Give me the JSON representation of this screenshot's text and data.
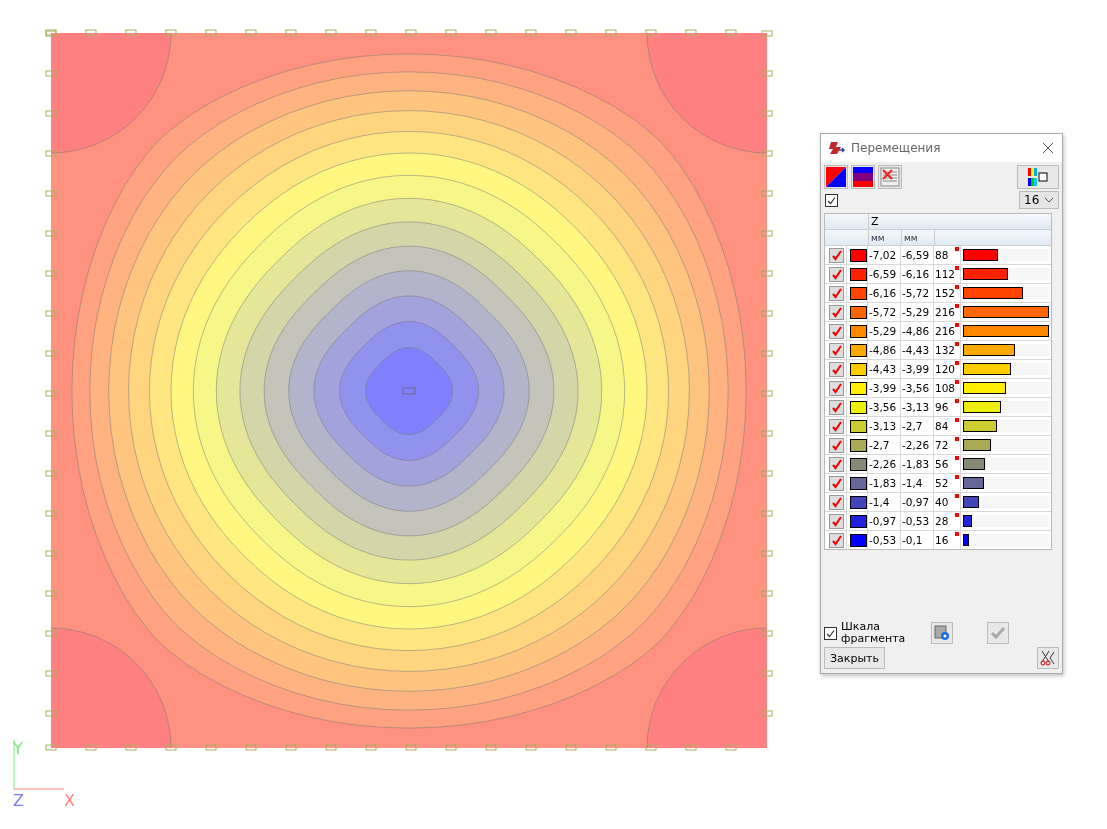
{
  "window": {
    "title": "Перемещения"
  },
  "all_checkbox": {
    "checked": true
  },
  "levels_select": {
    "value": "16"
  },
  "table": {
    "group_header": "Z",
    "units": [
      "мм",
      "мм"
    ],
    "rows": [
      {
        "checked": true,
        "color": "#ff0000",
        "from": "-7,02",
        "to": "-6,59",
        "count": "88",
        "level": 0.41
      },
      {
        "checked": true,
        "color": "#ff2200",
        "from": "-6,59",
        "to": "-6,16",
        "count": "112",
        "level": 0.52
      },
      {
        "checked": true,
        "color": "#ff4400",
        "from": "-6,16",
        "to": "-5,72",
        "count": "152",
        "level": 0.7
      },
      {
        "checked": true,
        "color": "#ff6600",
        "from": "-5,72",
        "to": "-5,29",
        "count": "216",
        "level": 1
      },
      {
        "checked": true,
        "color": "#ff8800",
        "from": "-5,29",
        "to": "-4,86",
        "count": "216",
        "level": 1
      },
      {
        "checked": true,
        "color": "#ffaa00",
        "from": "-4,86",
        "to": "-4,43",
        "count": "132",
        "level": 0.61
      },
      {
        "checked": true,
        "color": "#ffcc00",
        "from": "-4,43",
        "to": "-3,99",
        "count": "120",
        "level": 0.56
      },
      {
        "checked": true,
        "color": "#ffee00",
        "from": "-3,99",
        "to": "-3,56",
        "count": "108",
        "level": 0.5
      },
      {
        "checked": true,
        "color": "#eeee11",
        "from": "-3,56",
        "to": "-3,13",
        "count": "96",
        "level": 0.44
      },
      {
        "checked": true,
        "color": "#cccc33",
        "from": "-3,13",
        "to": "-2,7",
        "count": "84",
        "level": 0.39
      },
      {
        "checked": true,
        "color": "#aaaa55",
        "from": "-2,7",
        "to": "-2,26",
        "count": "72",
        "level": 0.33
      },
      {
        "checked": true,
        "color": "#888877",
        "from": "-2,26",
        "to": "-1,83",
        "count": "56",
        "level": 0.26
      },
      {
        "checked": true,
        "color": "#666699",
        "from": "-1,83",
        "to": "-1,4",
        "count": "52",
        "level": 0.24
      },
      {
        "checked": true,
        "color": "#4444bb",
        "from": "-1,4",
        "to": "-0,97",
        "count": "40",
        "level": 0.19
      },
      {
        "checked": true,
        "color": "#2222dd",
        "from": "-0,97",
        "to": "-0,53",
        "count": "28",
        "level": 0.11
      },
      {
        "checked": true,
        "color": "#0000ff",
        "from": "-0,53",
        "to": "-0,1",
        "count": "16",
        "level": 0.07
      }
    ]
  },
  "fragment_scale": {
    "label": "Шкала фрагмента",
    "checked": true
  },
  "close_button": {
    "label": "Закрыть"
  },
  "axes": {
    "y": "Y",
    "z": "Z",
    "x": "X"
  }
}
